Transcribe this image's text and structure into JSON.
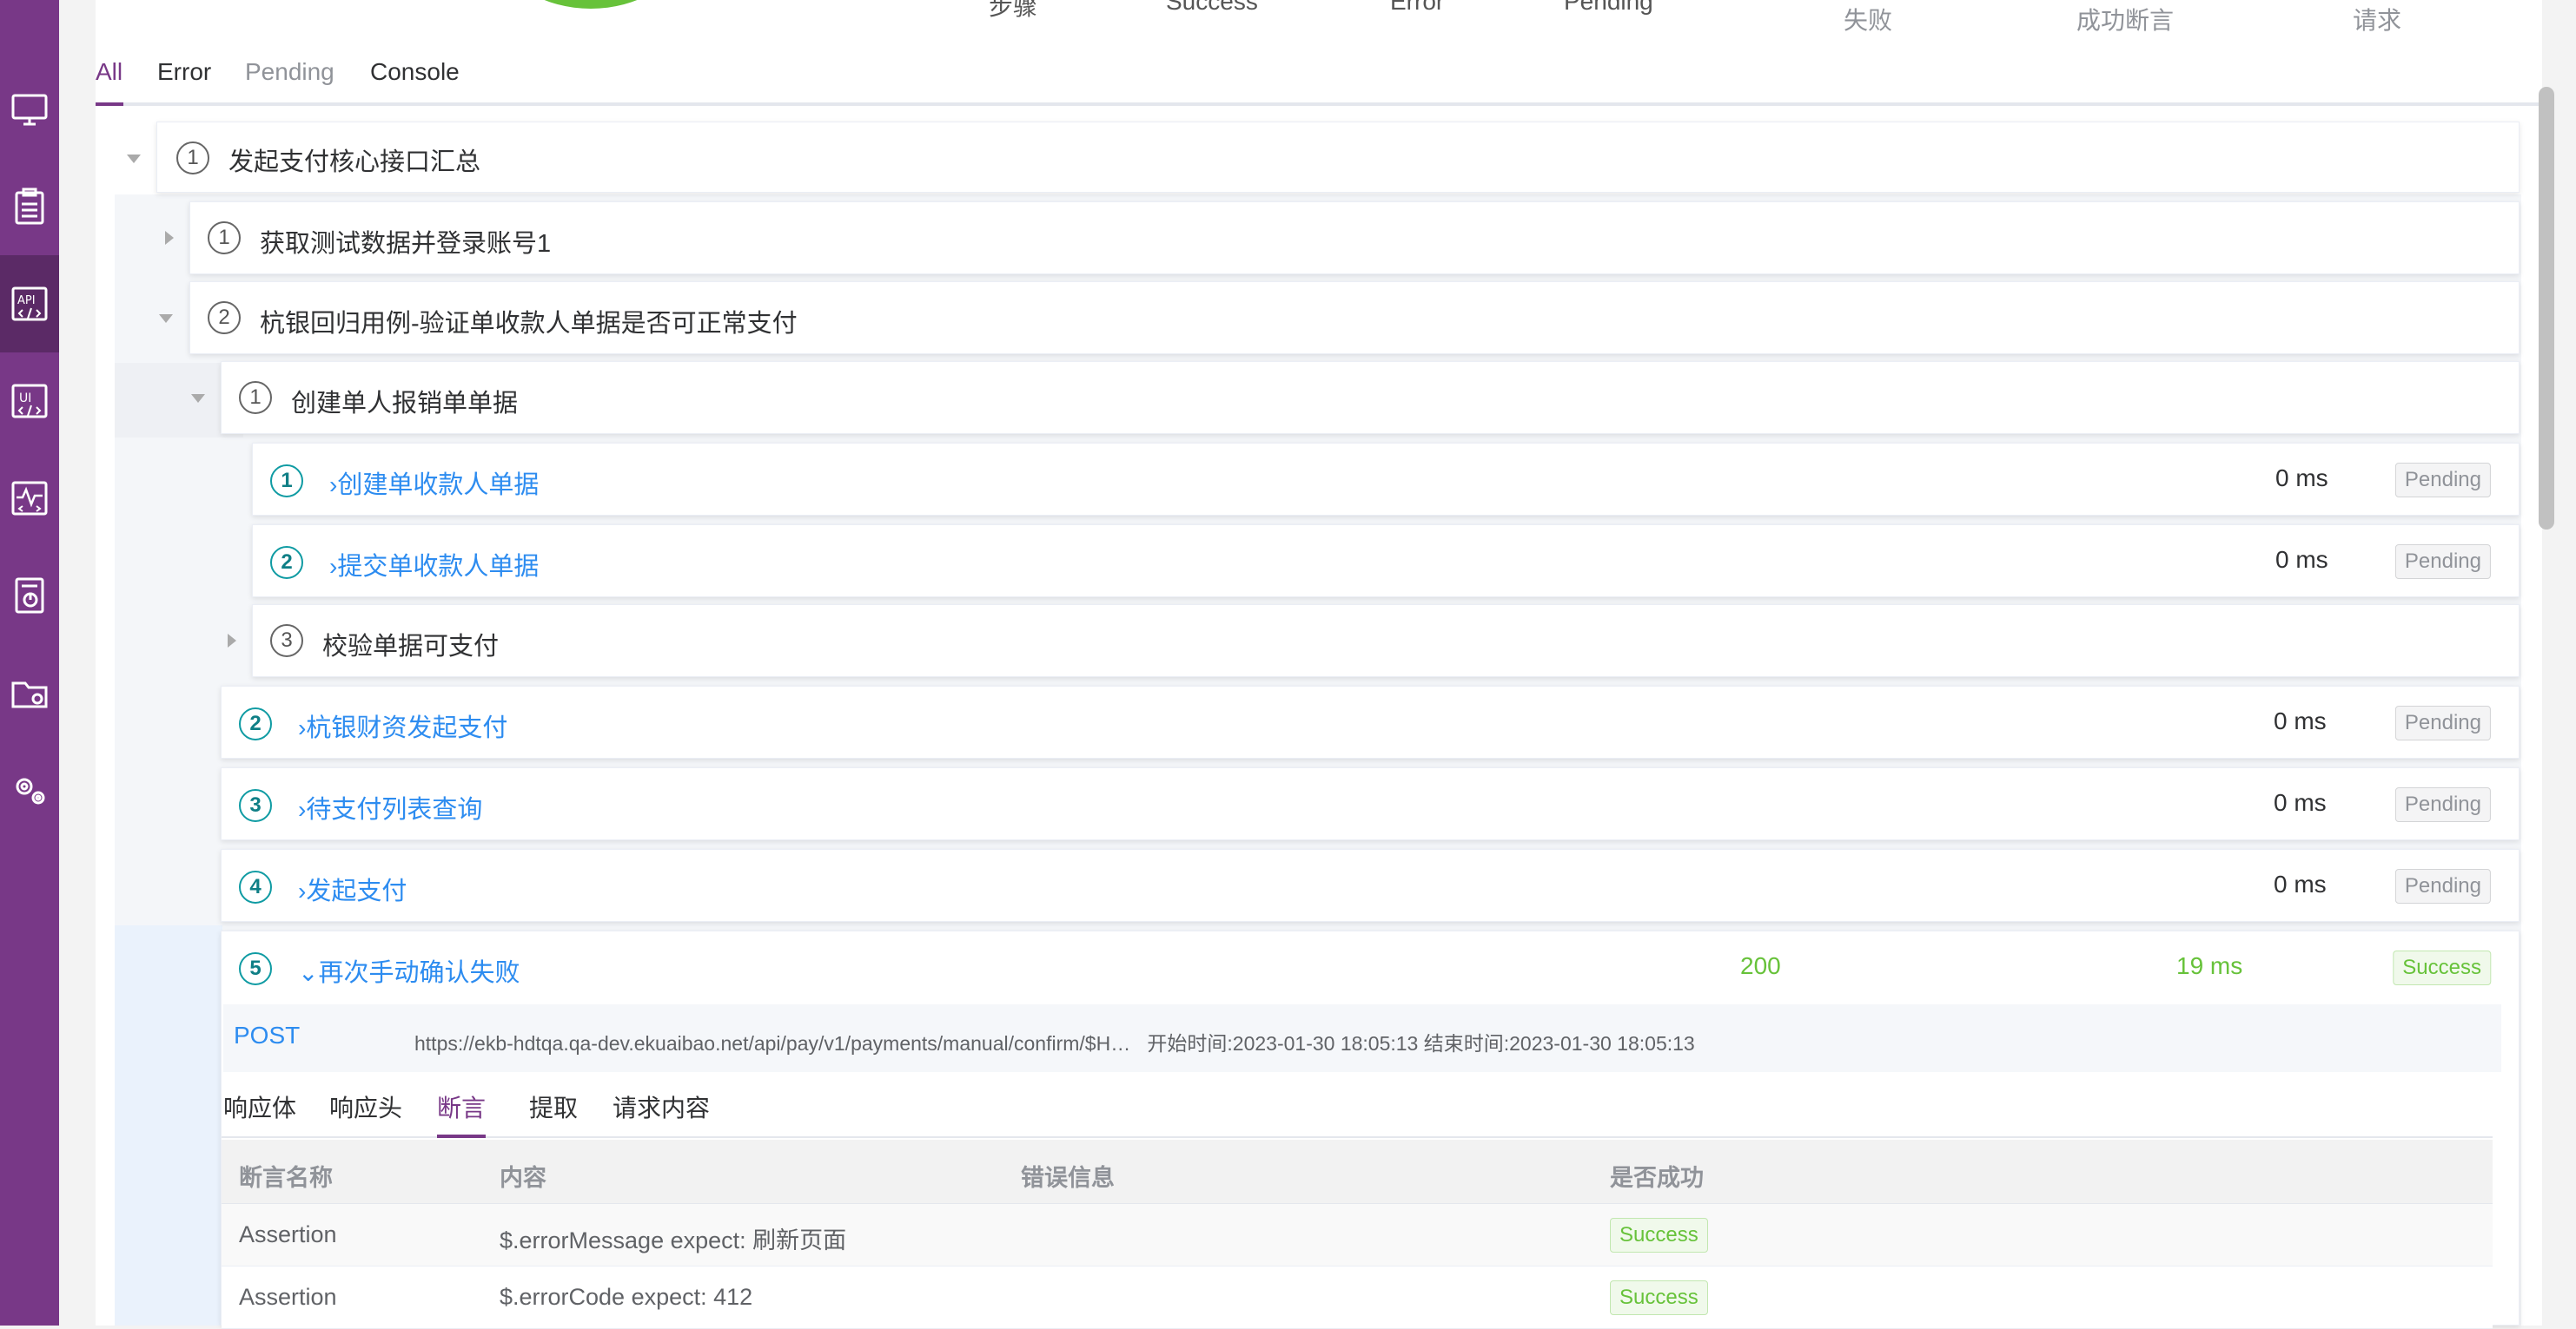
{
  "summary": {
    "labels": [
      "步骤",
      "Success",
      "Error",
      "Pending"
    ],
    "grey_labels": [
      "失败",
      "成功断言",
      "请求"
    ]
  },
  "tabs": [
    {
      "label": "All",
      "active": true
    },
    {
      "label": "Error"
    },
    {
      "label": "Pending"
    },
    {
      "label": "Console"
    }
  ],
  "tree": {
    "root": {
      "num": "1",
      "title": "发起支付核心接口汇总"
    },
    "n1": {
      "num": "1",
      "title": "获取测试数据并登录账号1"
    },
    "n2": {
      "num": "2",
      "title": "杭银回归用例-验证单收款人单据是否可正常支付"
    },
    "n21": {
      "num": "1",
      "title": "创建单人报销单单据"
    },
    "a1": {
      "num": "1",
      "title": "创建单收款人单据",
      "ms": "0 ms",
      "status": "Pending"
    },
    "a2": {
      "num": "2",
      "title": "提交单收款人单据",
      "ms": "0 ms",
      "status": "Pending"
    },
    "n213": {
      "num": "3",
      "title": "校验单据可支付"
    },
    "b2": {
      "num": "2",
      "title": "杭银财资发起支付",
      "ms": "0 ms",
      "status": "Pending"
    },
    "b3": {
      "num": "3",
      "title": "待支付列表查询",
      "ms": "0 ms",
      "status": "Pending"
    },
    "b4": {
      "num": "4",
      "title": "发起支付",
      "ms": "0 ms",
      "status": "Pending"
    },
    "b5": {
      "num": "5",
      "title": "再次手动确认失败",
      "code": "200",
      "ms": "19 ms",
      "status": "Success"
    }
  },
  "request": {
    "method": "POST",
    "url": "https://ekb-hdtqa.qa-dev.ekuaibao.net/api/pay/v1/payments/manual/confirm/$H…",
    "start_label": "开始时间:",
    "start_time": "2023-01-30 18:05:13",
    "end_label": "结束时间:",
    "end_time": "2023-01-30 18:05:13"
  },
  "detail_tabs": [
    "响应体",
    "响应头",
    "断言",
    "提取",
    "请求内容"
  ],
  "assertions": {
    "columns": [
      "断言名称",
      "内容",
      "错误信息",
      "是否成功"
    ],
    "rows": [
      {
        "name": "Assertion",
        "content": "$.errorMessage expect: 刷新页面",
        "error": "",
        "result": "Success"
      },
      {
        "name": "Assertion",
        "content": "$.errorCode expect: 412",
        "error": "",
        "result": "Success"
      }
    ]
  },
  "colors": {
    "sidebar": "#783887",
    "accent": "#783887",
    "link": "#2d8cf0",
    "success": "#67c23a",
    "pending": "#909399"
  },
  "icons": [
    "monitor-icon",
    "clipboard-icon",
    "api-icon",
    "ui-icon",
    "performance-icon",
    "report-icon",
    "folder-icon",
    "settings-icon"
  ]
}
